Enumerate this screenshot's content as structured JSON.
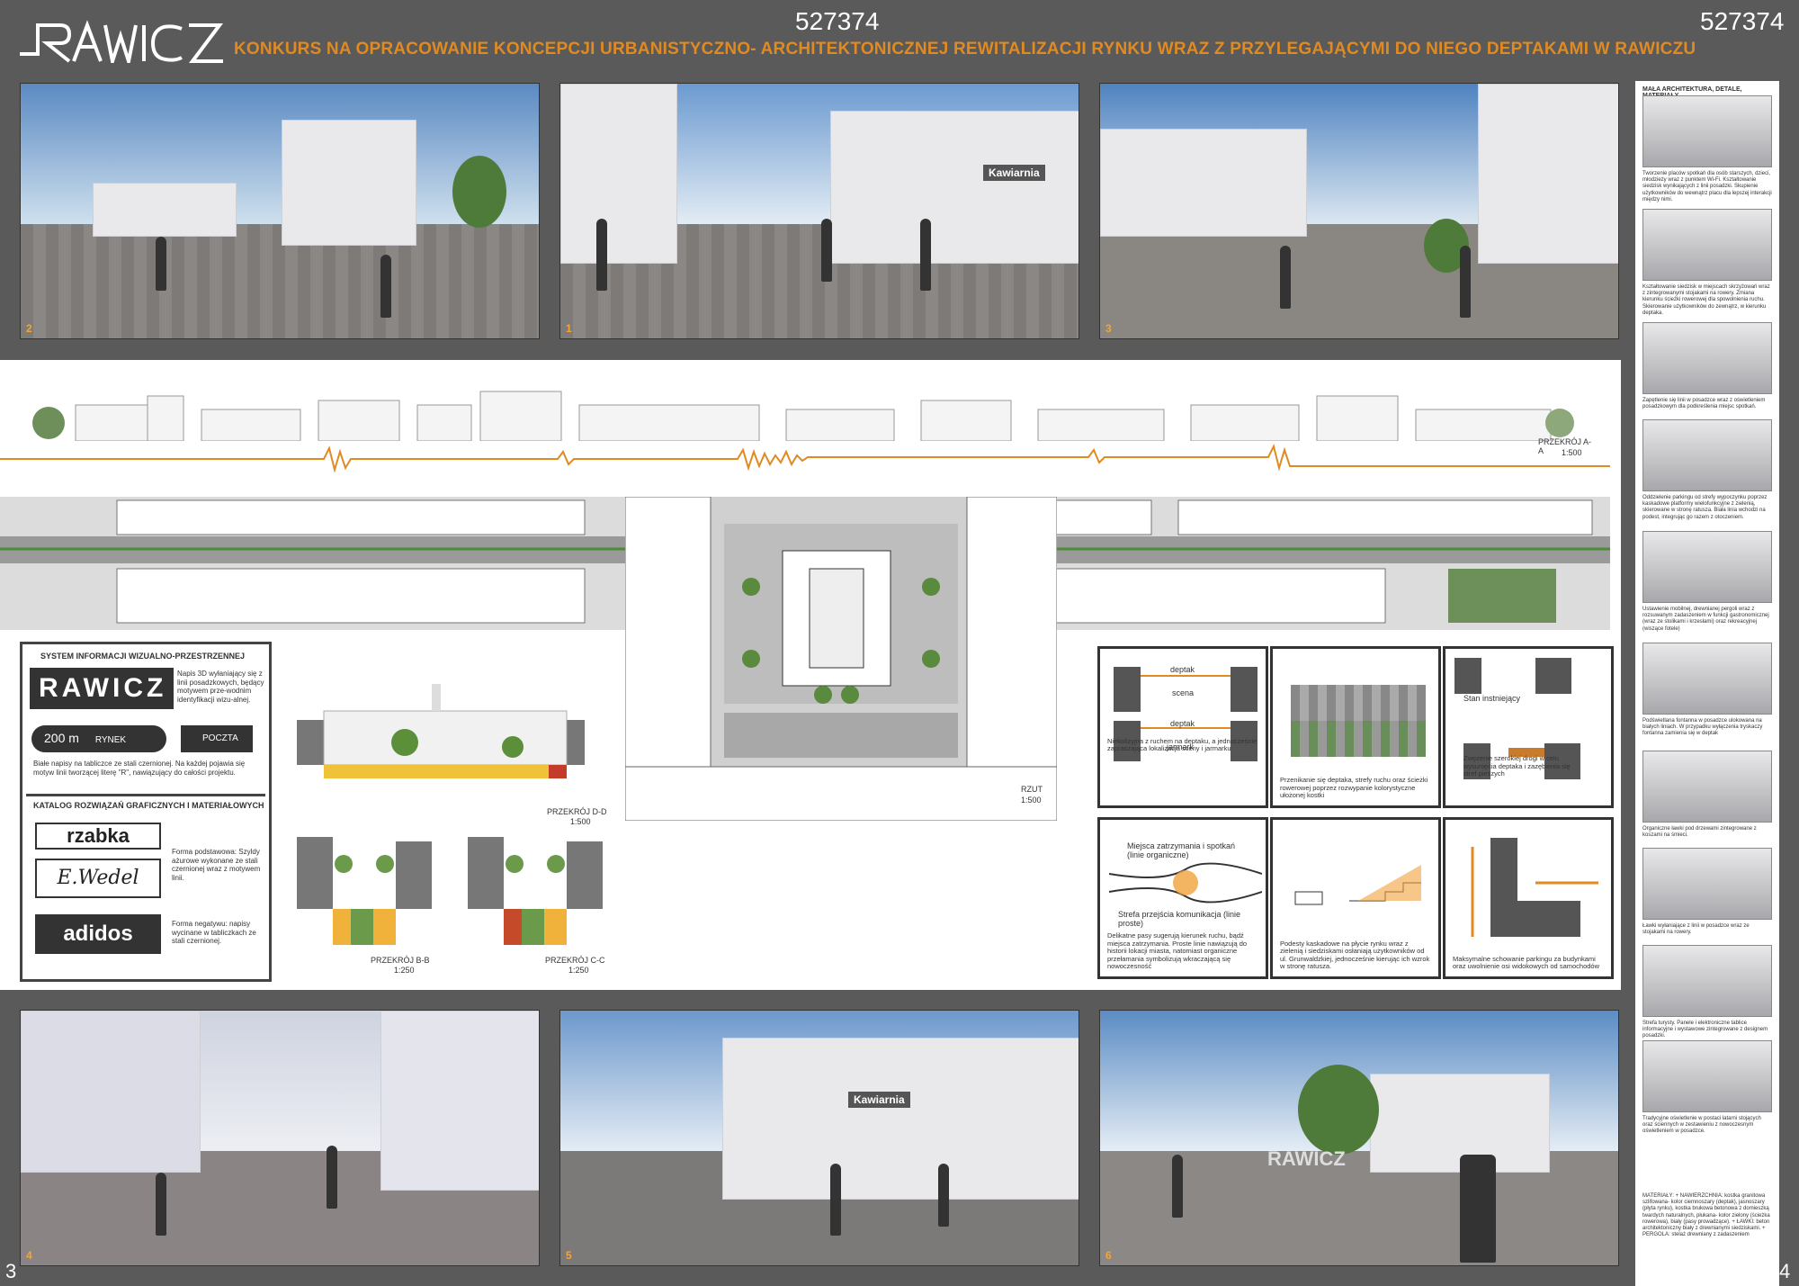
{
  "header": {
    "logo_text": "RAWICZ",
    "title": "KONKURS NA OPRACOWANIE KONCEPCJI URBANISTYCZNO- ARCHITEKTONICZNEJ REWITALIZACJI RYNKU WRAZ Z PRZYLEGAJĄCYMI DO NIEGO DEPTAKAMI W RAWICZU",
    "number_center": "527374",
    "number_right": "527374"
  },
  "top_photos": [
    {
      "caption": "2"
    },
    {
      "caption": "1",
      "sign": "Kawiarnia"
    },
    {
      "caption": "3"
    }
  ],
  "bottom_photos": [
    {
      "caption": "4"
    },
    {
      "caption": "5",
      "sign": "Kawiarnia"
    },
    {
      "caption": "6",
      "sign": "RAWICZ"
    }
  ],
  "section_aa": {
    "label": "PRZEKRÓJ A-A",
    "scale": "1:500"
  },
  "plan": {
    "label": "RZUT",
    "scale": "1:500"
  },
  "info": {
    "heading": "SYSTEM INFORMACJI WIZUALNO-PRZESTRZENNEJ",
    "logo_desc": "Napis 3D wyłaniający się z linii posadzkowych, będący motywem prze-wodnim identyfikacji wizu-alnej.",
    "sign_rynek_dist": "200 m",
    "sign_rynek_label": "RYNEK",
    "sign_poczta_label": "POCZTA",
    "white_text": "Białe napisy na tabliczce ze stali czernionej. Na każdej pojawia się motyw linii tworzącej literę \"R\", nawiązujący do całości projektu.",
    "catalog_heading": "KATALOG ROZWIĄZAŃ GRAFICZNYCH I MATERIAŁOWYCH",
    "brand1": "rzabka",
    "brand2": "E.Wedel",
    "brand3": "adidos",
    "positive_text": "Forma podstawowa: Szyldy ażurowe wykonane ze stali czernionej wraz z motywem linii.",
    "negative_text": "Forma negatywu: napisy wycinane w tabliczkach ze stali czernionej."
  },
  "sections": {
    "dd": {
      "label": "PRZEKRÓJ D-D",
      "scale": "1:500"
    },
    "bb": {
      "label": "PRZEKRÓJ B-B",
      "scale": "1:250"
    },
    "cc": {
      "label": "PRZEKRÓJ C-C",
      "scale": "1:250"
    }
  },
  "details": [
    {
      "tag1": "deptak",
      "tag2": "scena",
      "tag3": "deptak",
      "tag4": "jarmark",
      "text": "Niekolizyjna z ruchem na deptaku, a jednocześnie zapraszająca lokalizacja sceny i jarmarku"
    },
    {
      "text": "Przenikanie się deptaka, strefy ruchu oraz ścieżki rowerowej poprzez rozwypanie kolorystyczne ułożonej kostki"
    },
    {
      "tag1": "Stan instniejący",
      "text": "Zwężenie szerokiej drogi w celu wysunięcia deptaka i zazębienia się stref pieszych"
    },
    {
      "tag1": "Miejsca zatrzymania i spotkań (linie organiczne)",
      "tag2": "Strefa przejścia komunikacja (linie proste)",
      "text": "Delikatne pasy sugerują kierunek ruchu, bądź miejsca zatrzymania. Proste linie nawiązują do historii lokacji miasta, natomiast organiczne przełamania symbolizują wkraczającą się nowoczesność"
    },
    {
      "text": "Podesty kaskadowe na płycie rynku wraz z zielenią i siedziskami osłaniają użytkowników od ul. Grunwaldzkiej, jednocześnie kierując ich wzrok w stronę ratusza."
    },
    {
      "text": "Maksymalne schowanie parkingu za budynkami oraz uwolnienie osi widokowych od samochodów"
    }
  ],
  "side": {
    "heading": "MAŁA ARCHITEKTURA, DETALE, MATERIAŁY",
    "items": [
      "Tworzenie placów spotkań dla osób starszych, dzieci, młodzieży wraz z punktem Wi-Fi. Kształtowanie siedzisk wynikających z linii posadzki. Skupienie użytkowników do wewnątrz placu dla lepszej interakcji między nimi.",
      "Kształtowanie siedzisk w miejscach skrzyżowań wraz z zintegrowanymi stojakami na rowery. Zmiana kierunku ścieżki rowerowej dla spowolnienia ruchu. Skierowanie użytkowników do zewnątrz, w kierunku deptaka.",
      "Zapętlenie się linii w posadzce wraz z oświetleniem posadzkowym dla podkreślenia miejsc spotkań.",
      "Oddzielenie parkingu od strefy wypoczynku poprzez kaskadowe platformy wielofunkcyjne z zielenią, skierowane w stronę ratusza. Biała linia wchodzi na podest, integrując go razem z otoczeniem.",
      "Ustawienie mobilnej, drewnianej pergoli wraz z rozsuwanym zadaszeniem w funkcji gastronomicznej (wraz ze stolikami i krzesłami) oraz rekreacyjnej (wiszące fotele)",
      "Podświetlana fontanna w posadzce ulokowana na białych liniach. W przypadku wyłączenia tryskaczy fontanna zamienia się w deptak",
      "Organiczne ławki pod drzewami zintegrowane z koszami na śmieci.",
      "Ławki wyłaniające z linii w posadzce wraz ze stojakami na rowery.",
      "Strefa turysty. Panele i elektroniczne tablice informacyjne i wystawowe zintegrowane z designem posadzki.",
      "Tradycyjne oświetlenie w postaci latarni stojących oraz ściennych w zestawieniu z nowoczesnym oświetleniem w posadzce.",
      "MATERIAŁY: + NAWIERZCHNIA: kostka granitowa szlifowana- kolor ciemnoszary (deptak), jasnoszary (płyta rynku), kostka brukowa betonowa z domieszką twardych naturalnych, płukana- kolor zielony (ścieżka rowerowa), biały (pasy prowadzące). + ŁAWKI: beton architektoniczny biały z drewnianymi siedziskami. + PERGOLA: stelaż drewniany z zadaszeniem"
    ]
  },
  "page_numbers": {
    "left": "3",
    "right": "4"
  },
  "colors": {
    "accent": "#e08a22",
    "background": "#5a5a5a"
  }
}
